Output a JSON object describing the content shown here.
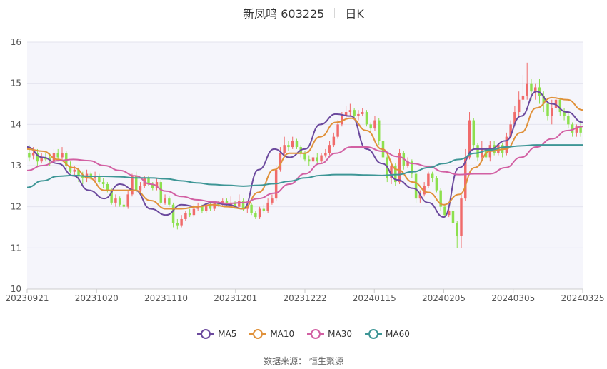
{
  "header": {
    "title": "新凤鸣 603225",
    "period": "日K"
  },
  "legend": [
    {
      "label": "MA5",
      "color": "#6c4a9e"
    },
    {
      "label": "MA10",
      "color": "#e0913a"
    },
    {
      "label": "MA30",
      "color": "#d260a3"
    },
    {
      "label": "MA60",
      "color": "#3e9696"
    }
  ],
  "source": "数据来源：  恒生聚源",
  "chart_data": {
    "type": "candlestick",
    "ylim": [
      10,
      16
    ],
    "yticks": [
      10,
      11,
      12,
      13,
      14,
      15,
      16
    ],
    "xticks": [
      "20230921",
      "20231020",
      "20231110",
      "20231201",
      "20231222",
      "20240115",
      "20240205",
      "20240305",
      "20240325"
    ],
    "up_color": "#f06b6b",
    "down_color": "#8de04e",
    "ma_series": [
      {
        "name": "MA5",
        "color": "#6c4a9e",
        "x": [
          0,
          6,
          12,
          18,
          24,
          30,
          36,
          42,
          48,
          54,
          60,
          66,
          72,
          78,
          84,
          90,
          96,
          102,
          108,
          114,
          120,
          126,
          132,
          138,
          144,
          150,
          156,
          162,
          168,
          174,
          180,
          186,
          192,
          196
        ],
        "y": [
          13.45,
          13.2,
          13.05,
          12.75,
          12.4,
          12.2,
          12.55,
          12.4,
          11.95,
          11.8,
          12.05,
          12.0,
          12.1,
          12.05,
          11.95,
          12.9,
          13.4,
          13.2,
          13.4,
          14.0,
          14.25,
          14.2,
          13.4,
          13.05,
          12.65,
          12.45,
          12.1,
          11.75,
          12.95,
          13.4,
          13.4,
          13.6,
          14.2,
          14.8,
          14.5,
          14.3,
          14.05
        ]
      },
      {
        "name": "MA10",
        "color": "#e0913a",
        "x": [
          0,
          6,
          12,
          18,
          24,
          30,
          36,
          42,
          48,
          54,
          60,
          66,
          72,
          78,
          84,
          90,
          96,
          102,
          108,
          114,
          120,
          126,
          132,
          138,
          144,
          150,
          156,
          162,
          168,
          174,
          180,
          186,
          192,
          196
        ],
        "y": [
          13.4,
          13.35,
          13.15,
          12.95,
          12.7,
          12.4,
          12.4,
          12.4,
          12.15,
          11.95,
          11.95,
          12.0,
          12.05,
          12.0,
          11.95,
          12.35,
          12.9,
          13.3,
          13.3,
          13.7,
          14.05,
          14.15,
          13.85,
          13.4,
          12.9,
          12.6,
          12.35,
          12.05,
          12.3,
          12.95,
          13.35,
          13.4,
          13.8,
          14.4,
          14.65,
          14.6,
          14.35
        ]
      },
      {
        "name": "MA30",
        "color": "#d260a3",
        "x": [
          0,
          6,
          12,
          18,
          24,
          30,
          36,
          42,
          48,
          54,
          60,
          66,
          72,
          78,
          84,
          90,
          96,
          102,
          108,
          114,
          120,
          126,
          132,
          138,
          144,
          150,
          156,
          162,
          168,
          174,
          180,
          186,
          192,
          196
        ],
        "y": [
          12.88,
          13.0,
          13.12,
          13.15,
          13.12,
          13.0,
          12.88,
          12.75,
          12.55,
          12.38,
          12.25,
          12.17,
          12.12,
          12.08,
          12.1,
          12.2,
          12.33,
          12.55,
          12.8,
          13.05,
          13.3,
          13.45,
          13.45,
          13.35,
          13.22,
          13.05,
          12.98,
          12.85,
          12.78,
          12.8,
          12.8,
          12.95,
          13.2,
          13.45,
          13.65,
          13.85,
          13.95
        ]
      },
      {
        "name": "MA60",
        "color": "#3e9696",
        "x": [
          0,
          6,
          12,
          18,
          24,
          30,
          36,
          42,
          48,
          54,
          60,
          66,
          72,
          78,
          84,
          90,
          96,
          102,
          108,
          114,
          120,
          126,
          132,
          138,
          144,
          150,
          156,
          162,
          168,
          174,
          180,
          186,
          192,
          196
        ],
        "y": [
          12.47,
          12.63,
          12.74,
          12.76,
          12.74,
          12.74,
          12.73,
          12.7,
          12.7,
          12.68,
          12.63,
          12.58,
          12.54,
          12.52,
          12.5,
          12.52,
          12.56,
          12.62,
          12.7,
          12.76,
          12.78,
          12.78,
          12.77,
          12.76,
          12.78,
          12.85,
          12.95,
          13.05,
          13.15,
          13.3,
          13.38,
          13.45,
          13.48,
          13.5,
          13.5,
          13.5,
          13.5
        ]
      }
    ],
    "candles": [
      [
        13.3,
        13.2,
        13.5,
        13.1
      ],
      [
        13.25,
        13.3,
        13.45,
        13.15
      ],
      [
        13.3,
        13.1,
        13.4,
        13.0
      ],
      [
        13.1,
        13.2,
        13.3,
        13.05
      ],
      [
        13.2,
        13.15,
        13.3,
        13.1
      ],
      [
        13.2,
        13.1,
        13.3,
        13.0
      ],
      [
        13.1,
        13.3,
        13.4,
        13.05
      ],
      [
        13.3,
        13.2,
        13.4,
        13.1
      ],
      [
        13.2,
        13.3,
        13.45,
        13.1
      ],
      [
        13.3,
        13.0,
        13.35,
        12.9
      ],
      [
        13.0,
        12.85,
        13.1,
        12.8
      ],
      [
        12.85,
        12.9,
        13.0,
        12.75
      ],
      [
        12.9,
        12.75,
        12.95,
        12.6
      ],
      [
        12.75,
        12.7,
        12.85,
        12.55
      ],
      [
        12.7,
        12.8,
        12.9,
        12.6
      ],
      [
        12.8,
        12.7,
        12.85,
        12.65
      ],
      [
        12.7,
        12.75,
        12.85,
        12.6
      ],
      [
        12.75,
        12.6,
        12.8,
        12.55
      ],
      [
        12.6,
        12.55,
        12.7,
        12.45
      ],
      [
        12.55,
        12.4,
        12.6,
        12.35
      ],
      [
        12.4,
        12.1,
        12.45,
        12.05
      ],
      [
        12.1,
        12.2,
        12.3,
        12.0
      ],
      [
        12.2,
        12.05,
        12.25,
        12.0
      ],
      [
        12.05,
        12.0,
        12.15,
        11.95
      ],
      [
        12.0,
        12.3,
        12.4,
        11.95
      ],
      [
        12.3,
        12.75,
        12.8,
        12.25
      ],
      [
        12.75,
        12.4,
        12.85,
        12.35
      ],
      [
        12.4,
        12.5,
        12.6,
        12.35
      ],
      [
        12.5,
        12.7,
        12.75,
        12.45
      ],
      [
        12.7,
        12.55,
        12.75,
        12.5
      ],
      [
        12.55,
        12.45,
        12.6,
        12.4
      ],
      [
        12.45,
        12.6,
        12.7,
        12.4
      ],
      [
        12.6,
        12.1,
        12.65,
        12.05
      ],
      [
        12.1,
        12.2,
        12.3,
        12.05
      ],
      [
        12.2,
        12.05,
        12.25,
        12.0
      ],
      [
        12.05,
        11.6,
        12.1,
        11.5
      ],
      [
        11.6,
        11.55,
        11.7,
        11.45
      ],
      [
        11.55,
        11.7,
        11.8,
        11.5
      ],
      [
        11.7,
        11.85,
        11.9,
        11.65
      ],
      [
        11.85,
        11.8,
        11.95,
        11.75
      ],
      [
        11.8,
        11.95,
        12.05,
        11.75
      ],
      [
        11.95,
        12.0,
        12.1,
        11.9
      ],
      [
        12.0,
        11.9,
        12.05,
        11.85
      ],
      [
        11.9,
        12.05,
        12.1,
        11.85
      ],
      [
        12.05,
        11.95,
        12.1,
        11.9
      ],
      [
        11.95,
        12.1,
        12.15,
        11.9
      ],
      [
        12.1,
        12.05,
        12.15,
        12.0
      ],
      [
        12.05,
        12.15,
        12.2,
        12.0
      ],
      [
        12.15,
        12.05,
        12.2,
        12.0
      ],
      [
        12.05,
        12.1,
        12.25,
        12.0
      ],
      [
        12.1,
        12.0,
        12.15,
        11.95
      ],
      [
        12.0,
        12.15,
        12.3,
        11.95
      ],
      [
        12.15,
        11.95,
        12.2,
        11.9
      ],
      [
        11.95,
        12.05,
        12.1,
        11.85
      ],
      [
        12.05,
        11.85,
        12.1,
        11.8
      ],
      [
        11.85,
        11.75,
        11.9,
        11.7
      ],
      [
        11.75,
        11.95,
        12.0,
        11.7
      ],
      [
        11.95,
        11.9,
        12.05,
        11.85
      ],
      [
        11.9,
        12.1,
        12.2,
        11.85
      ],
      [
        12.1,
        12.2,
        12.3,
        12.05
      ],
      [
        12.2,
        12.9,
        13.0,
        12.15
      ],
      [
        12.9,
        13.3,
        13.45,
        12.85
      ],
      [
        13.3,
        13.5,
        13.7,
        13.25
      ],
      [
        13.5,
        13.45,
        13.6,
        13.35
      ],
      [
        13.45,
        13.6,
        13.7,
        13.4
      ],
      [
        13.6,
        13.45,
        13.65,
        13.4
      ],
      [
        13.45,
        13.3,
        13.5,
        13.2
      ],
      [
        13.3,
        13.15,
        13.35,
        13.1
      ],
      [
        13.15,
        13.1,
        13.25,
        13.0
      ],
      [
        13.1,
        13.2,
        13.3,
        13.05
      ],
      [
        13.2,
        13.1,
        13.3,
        13.05
      ],
      [
        13.1,
        13.25,
        13.3,
        13.05
      ],
      [
        13.25,
        13.3,
        13.4,
        13.2
      ],
      [
        13.3,
        13.5,
        13.6,
        13.25
      ],
      [
        13.5,
        13.7,
        13.8,
        13.45
      ],
      [
        13.7,
        14.0,
        14.1,
        13.65
      ],
      [
        14.0,
        14.2,
        14.3,
        13.95
      ],
      [
        14.2,
        14.3,
        14.45,
        14.15
      ],
      [
        14.3,
        14.35,
        14.5,
        14.2
      ],
      [
        14.35,
        14.2,
        14.4,
        14.15
      ],
      [
        14.2,
        14.25,
        14.35,
        14.1
      ],
      [
        14.25,
        14.3,
        14.4,
        14.2
      ],
      [
        14.3,
        14.0,
        14.35,
        13.95
      ],
      [
        14.0,
        13.9,
        14.05,
        13.85
      ],
      [
        13.9,
        14.1,
        14.2,
        13.85
      ],
      [
        14.1,
        13.6,
        14.15,
        13.5
      ],
      [
        13.6,
        13.2,
        13.65,
        13.1
      ],
      [
        13.2,
        12.7,
        13.25,
        12.6
      ],
      [
        12.7,
        13.0,
        13.1,
        12.55
      ],
      [
        13.0,
        12.6,
        13.05,
        12.5
      ],
      [
        12.6,
        13.3,
        13.4,
        12.55
      ],
      [
        13.3,
        13.0,
        13.35,
        12.9
      ],
      [
        13.0,
        13.1,
        13.2,
        12.95
      ],
      [
        13.1,
        12.8,
        13.15,
        12.7
      ],
      [
        12.8,
        12.2,
        12.85,
        12.1
      ],
      [
        12.2,
        12.3,
        12.4,
        12.1
      ],
      [
        12.3,
        12.5,
        12.6,
        12.25
      ],
      [
        12.5,
        12.8,
        12.85,
        12.45
      ],
      [
        12.8,
        12.7,
        12.85,
        12.6
      ],
      [
        12.7,
        12.4,
        12.75,
        12.35
      ],
      [
        12.4,
        12.0,
        12.45,
        11.9
      ],
      [
        12.0,
        11.8,
        12.05,
        11.75
      ],
      [
        11.8,
        11.9,
        12.0,
        11.75
      ],
      [
        11.9,
        11.6,
        11.95,
        11.5
      ],
      [
        11.6,
        11.3,
        11.65,
        11.0
      ],
      [
        11.3,
        12.2,
        12.3,
        11.0
      ],
      [
        12.2,
        13.2,
        13.4,
        12.15
      ],
      [
        13.2,
        14.1,
        14.3,
        13.15
      ],
      [
        14.1,
        13.5,
        14.15,
        13.4
      ],
      [
        13.5,
        13.2,
        13.55,
        13.1
      ],
      [
        13.2,
        13.4,
        13.6,
        13.15
      ],
      [
        13.4,
        13.2,
        13.45,
        13.15
      ],
      [
        13.2,
        13.5,
        13.6,
        13.1
      ],
      [
        13.5,
        13.3,
        13.6,
        13.25
      ],
      [
        13.3,
        13.5,
        13.55,
        13.25
      ],
      [
        13.5,
        13.3,
        13.55,
        13.2
      ],
      [
        13.3,
        13.7,
        13.8,
        13.25
      ],
      [
        13.7,
        14.0,
        14.1,
        13.65
      ],
      [
        14.0,
        14.3,
        14.45,
        13.95
      ],
      [
        14.3,
        14.6,
        14.8,
        14.2
      ],
      [
        14.6,
        14.7,
        15.2,
        14.5
      ],
      [
        14.7,
        15.0,
        15.5,
        14.6
      ],
      [
        15.0,
        14.8,
        15.1,
        14.6
      ],
      [
        14.8,
        14.9,
        15.0,
        14.6
      ],
      [
        14.9,
        14.7,
        15.1,
        14.5
      ],
      [
        14.7,
        14.5,
        14.8,
        14.3
      ],
      [
        14.5,
        14.2,
        14.55,
        14.1
      ],
      [
        14.2,
        14.4,
        14.6,
        14.0
      ],
      [
        14.4,
        14.6,
        14.8,
        14.3
      ],
      [
        14.6,
        14.3,
        14.65,
        14.2
      ],
      [
        14.3,
        14.2,
        14.4,
        14.1
      ],
      [
        14.2,
        14.0,
        14.3,
        13.9
      ],
      [
        14.0,
        13.8,
        14.05,
        13.7
      ],
      [
        13.8,
        13.95,
        14.0,
        13.7
      ],
      [
        13.95,
        13.8,
        14.1,
        13.7
      ]
    ]
  }
}
